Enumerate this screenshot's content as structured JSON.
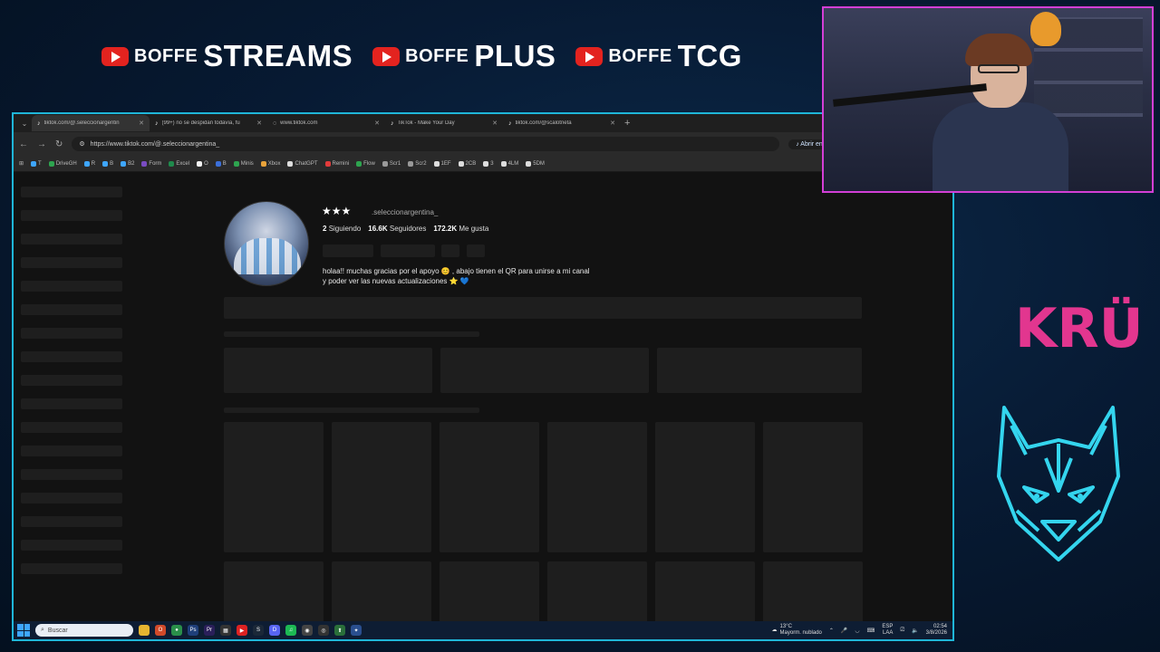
{
  "banner": [
    {
      "a": "BOFFE",
      "b": "STREAMS"
    },
    {
      "a": "BOFFE",
      "b": "PLUS"
    },
    {
      "a": "BOFFE",
      "b": "TCG"
    }
  ],
  "tabs": [
    {
      "label": "tiktok.com/@.seleccionargentin",
      "active": true
    },
    {
      "label": "(99+) no se despidan todavía, fu",
      "active": false
    },
    {
      "label": "www.tiktok.com",
      "active": false
    },
    {
      "label": "TikTok - Make Your Day",
      "active": false
    },
    {
      "label": "tiktok.com/@scalotneta",
      "active": false
    }
  ],
  "toolbar": {
    "url": "https://www.tiktok.com/@.seleccionargentina_",
    "open_app": "Abrir en aplicació"
  },
  "bookmarks": [
    {
      "label": "T",
      "color": "#3ea6ff"
    },
    {
      "label": "DriveGH",
      "color": "#2ea44f"
    },
    {
      "label": "R",
      "color": "#3ea6ff"
    },
    {
      "label": "B",
      "color": "#3ea6ff"
    },
    {
      "label": "B2",
      "color": "#3ea6ff"
    },
    {
      "label": "Form",
      "color": "#7a4cc2"
    },
    {
      "label": "Excel",
      "color": "#1f8a4c"
    },
    {
      "label": "O",
      "color": "#f2f2f2"
    },
    {
      "label": "B",
      "color": "#3b6fd9"
    },
    {
      "label": "Minis",
      "color": "#2ea44f"
    },
    {
      "label": "Xbox",
      "color": "#e8a23a"
    },
    {
      "label": "ChatGPT",
      "color": "#dddddd"
    },
    {
      "label": "Remini",
      "color": "#e23b3b"
    },
    {
      "label": "Flow",
      "color": "#2ea44f"
    },
    {
      "label": "Scr1",
      "color": "#999999"
    },
    {
      "label": "Scr2",
      "color": "#999999"
    },
    {
      "label": "1EF",
      "color": "#dddddd"
    },
    {
      "label": "2CB",
      "color": "#dddddd"
    },
    {
      "label": "3",
      "color": "#dddddd"
    },
    {
      "label": "4LM",
      "color": "#dddddd"
    },
    {
      "label": "5DM",
      "color": "#dddddd"
    }
  ],
  "profile": {
    "stars": "★★★",
    "username": ".seleccionargentina_",
    "following_count": "2",
    "following_label": "Siguiendo",
    "followers_count": "16.6K",
    "followers_label": "Seguidores",
    "likes_count": "172.2K",
    "likes_label": "Me gusta",
    "bio_line1": "holaa!! muchas gracias por el apoyo 😊 , abajo tienen el QR para unirse a mi canal",
    "bio_line2": "y poder ver las nuevas actualizaciones ⭐ 💙"
  },
  "taskbar": {
    "search_placeholder": "Buscar",
    "weather_temp": "13°C",
    "weather_desc": "Mayorm. nublado",
    "lang1": "ESP",
    "lang2": "LAA",
    "time": "02:54",
    "date": "3/8/2026"
  },
  "overlay": {
    "logo_text": "KRÜ"
  }
}
